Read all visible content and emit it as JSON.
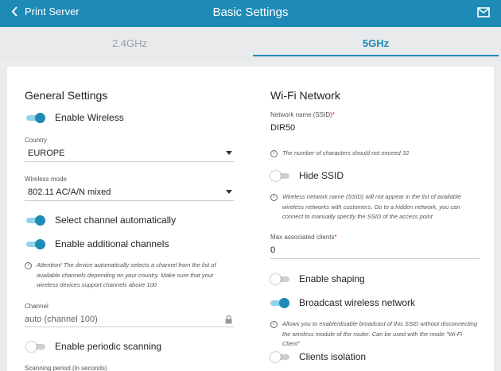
{
  "header": {
    "back_label": "Print Server",
    "title": "Basic Settings",
    "mail_icon": "envelope-icon",
    "color": "#1e8ab6"
  },
  "tabs": [
    {
      "label": "2.4GHz",
      "active": false
    },
    {
      "label": "5GHz",
      "active": true
    }
  ],
  "general": {
    "heading": "General Settings",
    "enable_wireless": {
      "label": "Enable Wireless",
      "on": true
    },
    "country": {
      "label": "Country",
      "value": "EUROPE"
    },
    "wireless_mode": {
      "label": "Wireless mode",
      "value": "802.11 AC/A/N mixed"
    },
    "select_channel_auto": {
      "label": "Select channel automatically",
      "on": true
    },
    "additional_channels": {
      "label": "Enable additional channels",
      "on": true
    },
    "attention_note": "Attention! The device automatically selects a channel from the list of available channels depending on your country. Make sure that your wireless devices support channels above 100",
    "channel": {
      "label": "Channel",
      "value": "auto (channel 100)"
    },
    "periodic_scanning": {
      "label": "Enable periodic scanning",
      "on": false
    },
    "scanning_period": {
      "label": "Scanning period (in seconds)"
    }
  },
  "wifi": {
    "heading": "Wi-Fi Network",
    "ssid": {
      "label": "Network name (SSID)",
      "required": "*",
      "value": "DIR50"
    },
    "ssid_note": "The number of characters should not exceed 32",
    "hide_ssid": {
      "label": "Hide SSID",
      "on": false
    },
    "hide_ssid_note": "Wireless network name (SSID) will not appear in the list of available wireless networks with customers. Go to a hidden network, you can connect to manually specify the SSID of the access point",
    "max_clients": {
      "label": "Max associated clients",
      "required": "*",
      "value": "0"
    },
    "shaping": {
      "label": "Enable shaping",
      "on": false
    },
    "broadcast": {
      "label": "Broadcast wireless network",
      "on": true
    },
    "broadcast_note": "Allows you to enable/disable broadcast of this SSID without disconnecting the wireless module of the router. Can be used with the mode \"Wi-Fi Client\"",
    "clients_isolation": {
      "label": "Clients isolation",
      "on": false
    }
  }
}
